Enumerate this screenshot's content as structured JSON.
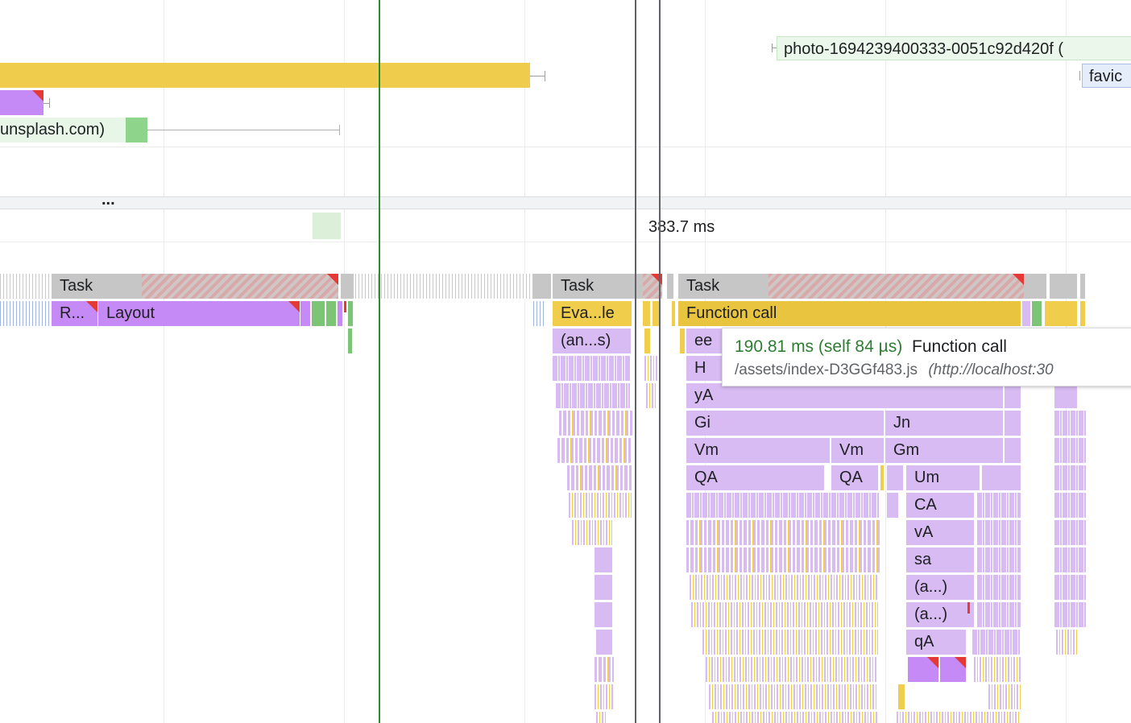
{
  "network": {
    "photo_request_label": "photo-1694239400333-0051c92d420f (",
    "favicon_label": "favic",
    "unsplash_label": "unsplash.com)"
  },
  "divider_dots": "...",
  "selection_duration": "383.7 ms",
  "main_track": {
    "task_label": "Task",
    "recalc_label": "R...",
    "layout_label": "Layout",
    "evaluate_label": "Eva...le",
    "anon_label": "(an...s)",
    "function_call_label": "Function call",
    "frames": {
      "ee": "ee",
      "H": "H",
      "yA": "yA",
      "Gi": "Gi",
      "Jn": "Jn",
      "Vm": "Vm",
      "Gm": "Gm",
      "QA": "QA",
      "Um": "Um",
      "CA": "CA",
      "vA": "vA",
      "sa": "sa",
      "anon": "(a...)",
      "qA": "qA"
    }
  },
  "tooltip": {
    "duration": "190.81 ms (self 84 µs)",
    "title": "Function call",
    "url": "/assets/index-D3GGf483.js",
    "origin": "(http://localhost:30"
  },
  "colors": {
    "scripting": "#f0cd4a",
    "rendering": "#c58af5",
    "function_frame": "#d8bbf3",
    "task": "#c6c6c6",
    "long_task_warning": "#e53935",
    "tooltip_duration": "#2e7d32"
  }
}
